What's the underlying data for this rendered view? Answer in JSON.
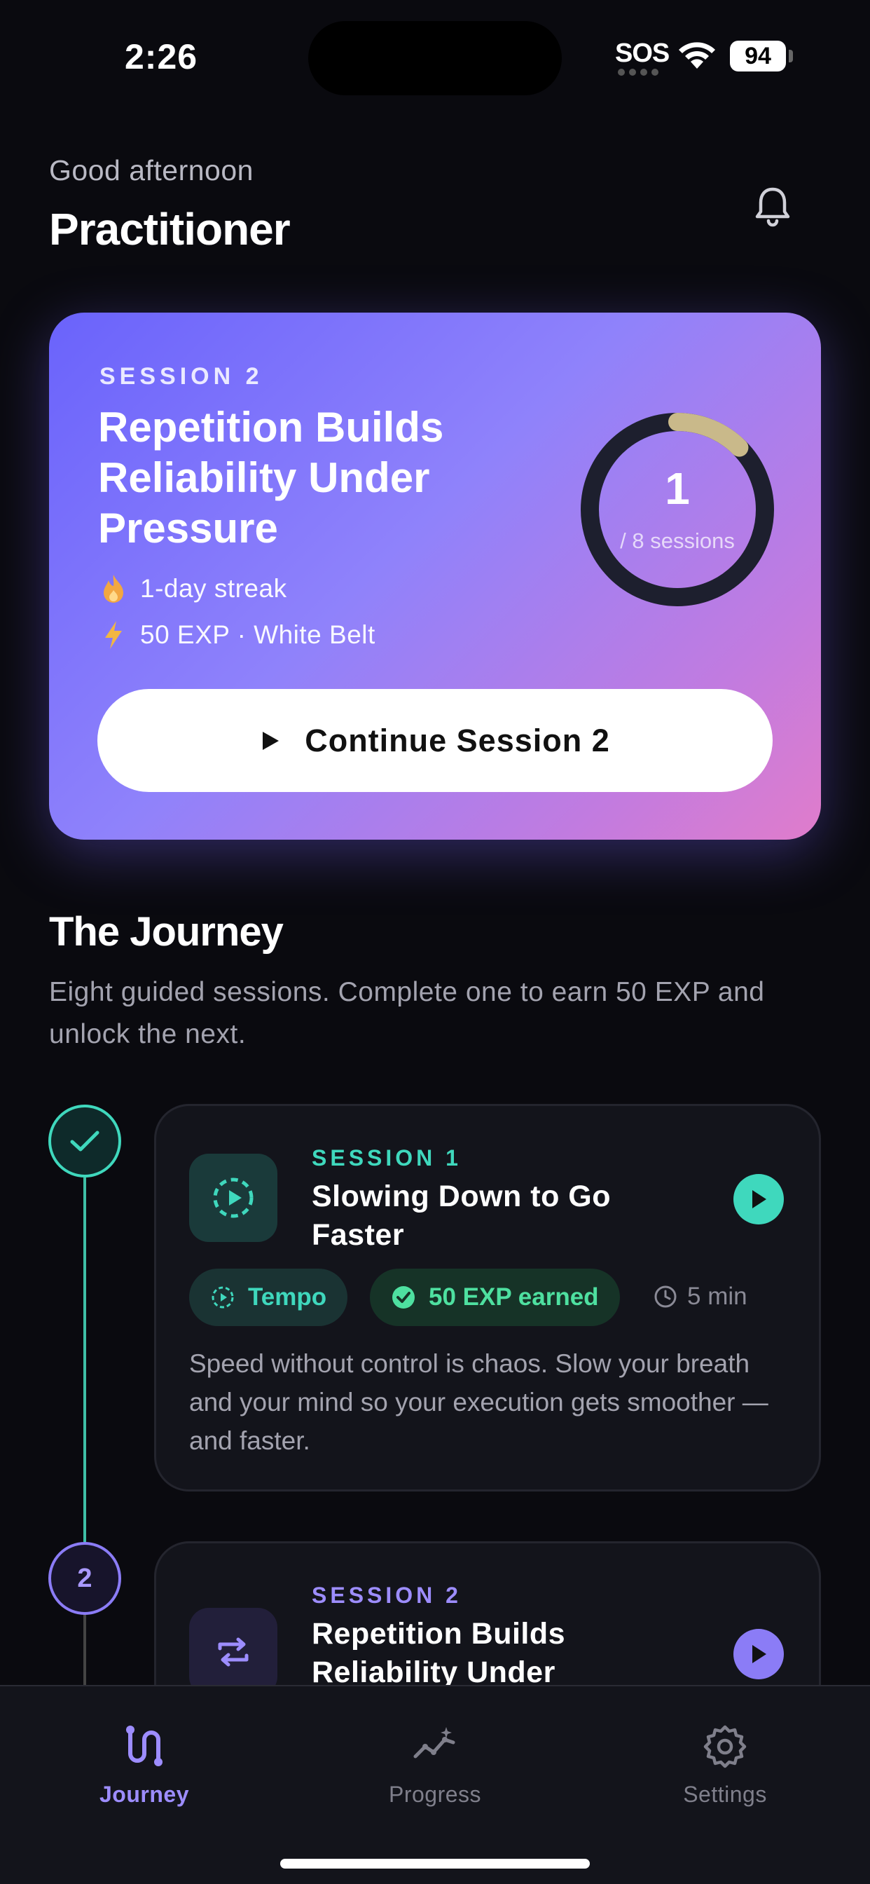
{
  "status_bar": {
    "time": "2:26",
    "sos": "SOS",
    "battery": "94"
  },
  "header": {
    "greeting": "Good afternoon",
    "username": "Practitioner"
  },
  "hero": {
    "session_label": "SESSION 2",
    "title": "Repetition Builds Reliability Under Pressure",
    "streak": "1-day streak",
    "exp": "50 EXP · White Belt",
    "progress_count": "1",
    "progress_total": "/ 8 sessions",
    "progress_fraction": 0.125,
    "cta_label": "Continue Session 2"
  },
  "journey": {
    "title": "The Journey",
    "description": "Eight guided sessions. Complete one to earn 50 EXP and unlock the next.",
    "sessions": [
      {
        "label": "SESSION 1",
        "title": "Slowing Down to Go Faster",
        "tag": "Tempo",
        "reward": "50 EXP earned",
        "duration": "5 min",
        "description": "Speed without control is chaos. Slow your breath and your mind so your execution gets smoother — and faster.",
        "status": "completed"
      },
      {
        "label": "SESSION 2",
        "title": "Repetition Builds Reliability Under",
        "node_number": "2",
        "status": "current"
      }
    ]
  },
  "tabbar": {
    "tabs": [
      {
        "label": "Journey",
        "icon": "journey-icon",
        "active": true
      },
      {
        "label": "Progress",
        "icon": "progress-icon",
        "active": false
      },
      {
        "label": "Settings",
        "icon": "gear-icon",
        "active": false
      }
    ]
  },
  "colors": {
    "accent_purple": "#8b7cf6",
    "accent_teal": "#3fd8bd",
    "ring_progress": "#c9b98a",
    "background": "#0a0a0f"
  }
}
